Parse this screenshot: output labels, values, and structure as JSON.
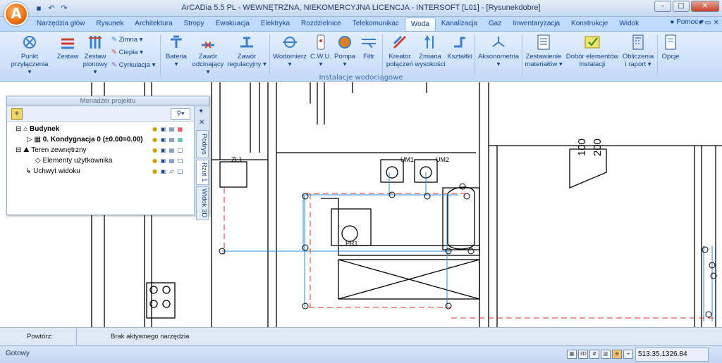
{
  "window": {
    "title": "ArCADia 5.5 PL - WEWNĘTRZNA, NIEKOMERCYJNA LICENCJA - INTERSOFT [L01] - [Rysunekdobre]",
    "app_button": "A",
    "controls": {
      "minimize": "–",
      "maximize": "□",
      "close": "✕"
    }
  },
  "tabs": [
    "Narzędzia głów",
    "Rysunek",
    "Architektura",
    "Stropy",
    "Ewakuacja",
    "Elektryka",
    "Rozdzielnice",
    "Telekomunikac",
    "Woda",
    "Kanalizacja",
    "Gaz",
    "Inwentaryzacja",
    "Konstrukcje",
    "Widok"
  ],
  "active_tab": "Woda",
  "help_label": "Pomoc",
  "ribbon": {
    "punkt": "Punkt\nprzyłączenia",
    "zestaw": "Zestaw",
    "zestaw_pionowy": "Zestaw\npionowy",
    "zimna": "Zimna",
    "ciepla": "Ciepła",
    "cyrkulacja": "Cyrkulacja",
    "bateria": "Bateria",
    "zawor_odcinajacy": "Zawór\nodcinający",
    "zawor_regulacyjny": "Zawór\nregulacyjny",
    "wodomierz": "Wodomierz",
    "cwu": "C.W.U.",
    "pompa": "Pompa",
    "filtr": "Filtr",
    "kreator": "Kreator\npołączeń",
    "zmiana": "Zmiana\nwysokości",
    "ksztaltki": "Kształtki",
    "aksonometria": "Aksonometria",
    "zestawienie": "Zestawienie\nmateriałów",
    "dobor": "Dobór elementów\ninstalacji",
    "obliczenia": "Obliczenia\ni raport",
    "opcje": "Opcje",
    "group_label": "Instalacje wodociągowe"
  },
  "manager": {
    "title": "Menadżer projektu",
    "items": {
      "budynek": "Budynek",
      "kondygnacja": "0. Kondygnacja 0 (±0.00=0.00)",
      "teren": "Teren zewnętrzny",
      "elementy": "Elementy użytkownika",
      "uchwyt": "Uchwyt widoku"
    },
    "vtabs": [
      "Podrys",
      "Rzut 1",
      "Widok 3D"
    ]
  },
  "drawing": {
    "labels": {
      "zl1": "ZL1",
      "um1": "UM1",
      "um2": "UM2",
      "pr1": "PR1",
      "dim100": "100",
      "dim200": "200"
    }
  },
  "command": {
    "repeat_label": "Powtórz:",
    "tool_status": "Brak aktywnego narzędzia"
  },
  "status": {
    "ready": "Gotowy",
    "coords": "513.35,1326.84"
  }
}
